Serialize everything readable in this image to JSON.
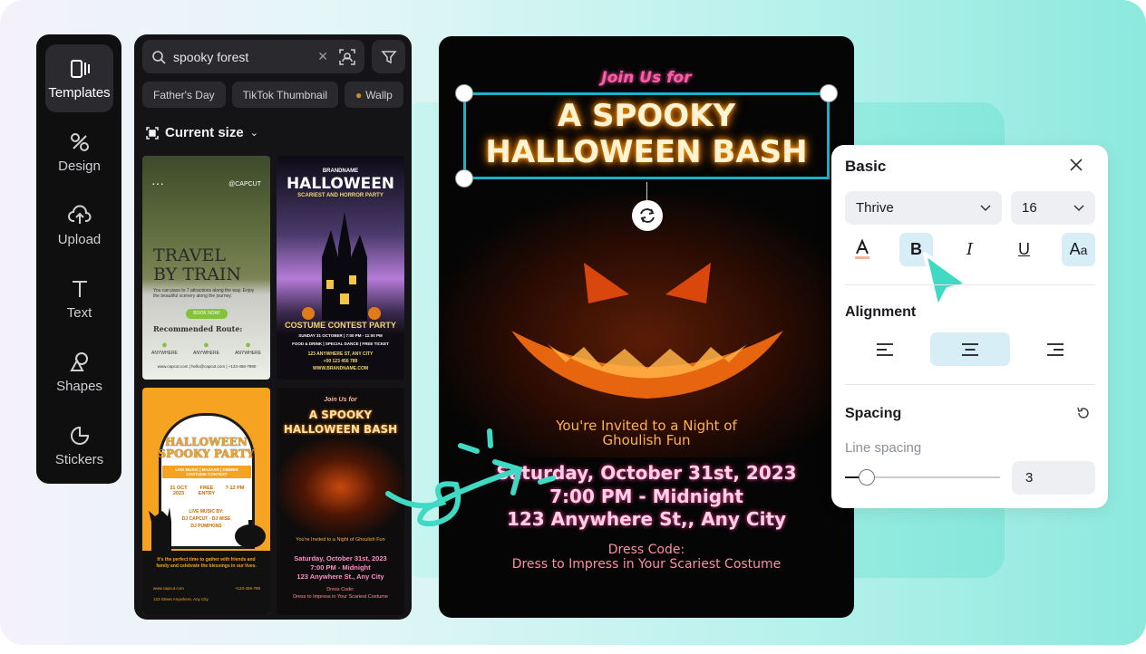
{
  "rail": {
    "items": [
      {
        "label": "Templates",
        "icon": "templates-icon"
      },
      {
        "label": "Design",
        "icon": "design-icon"
      },
      {
        "label": "Upload",
        "icon": "upload-icon"
      },
      {
        "label": "Text",
        "icon": "text-icon"
      },
      {
        "label": "Shapes",
        "icon": "shapes-icon"
      },
      {
        "label": "Stickers",
        "icon": "stickers-icon"
      }
    ]
  },
  "templates": {
    "search_value": "spooky forest",
    "chips": [
      "Father's Day",
      "TikTok Thumbnail",
      "Wallp"
    ],
    "size_label": "Current size",
    "t1": {
      "title1": "TRAVEL",
      "title2": "BY TRAIN",
      "handle": "@CAPCUT",
      "body": "You can pass to 7 attractions along the way. Enjoy the beautiful scenery along the journey.",
      "button": "BOOK NOW!",
      "route": "Recommended Route:",
      "stop": "ANYWHERE",
      "footer": "www.capcut.com | hello@capcut.com | +123-456-7890"
    },
    "t2": {
      "brand": "BRANDNAME",
      "title": "HALLOWEEN",
      "subtitle": "SCARIEST AND HORROR PARTY",
      "headline": "COSTUME CONTEST PARTY",
      "line1": "SUNDAY 31 OCTOBER | 7:00 PM - 11:00 PM",
      "line2": "FOOD & DRINK | SPECIAL DANCE | FREE TICKET",
      "line3": "123 ANYWHERE ST, ANY CITY",
      "line4": "+00 123 456 789",
      "line5": "WWW.BRANDNAME.COM"
    },
    "t3": {
      "title1": "HALLOWEEN",
      "title2": "SPOOKY PARTY",
      "tags1": "LIVE MUSIC | BAZAAR | DINNER",
      "tags2": "COSTUME CONTEST",
      "date": "31 OCT 2023",
      "entry": "FREE ENTRY",
      "time": "7-12 PM",
      "lm": "LIVE MUSIC BY:",
      "dj": "DJ CAPCUT - DJ WISE",
      "dj2": "DJ PUMPKINS",
      "blurb": "It's the perfect time to gather with friends and family and celebrate the blessings in our lives.",
      "web": "www.capcut.com",
      "phone": "+123-456-789",
      "addr": "123 Street Anywhere, Any City"
    },
    "t4": {
      "top": "Join Us for",
      "title1": "A SPOOKY",
      "title2": "HALLOWEEN BASH",
      "invite": "You're Invited to a Night of Ghoulish Fun",
      "date": "Saturday, October 31st, 2023",
      "time": "7:00 PM - Midnight",
      "addr": "123 Anywhere St., Any City",
      "dc": "Dress Code:",
      "dc2": "Dress to Impress in Your Scariest Costume"
    }
  },
  "canvas": {
    "top": "Join Us for",
    "title1": "A SPOOKY",
    "title2": "HALLOWEEN BASH",
    "invite1": "You're Invited to a Night of",
    "invite2": "Ghoulish Fun",
    "date": "Saturday, October 31st, 2023",
    "time": "7:00 PM - Midnight",
    "addr": "123 Anywhere St,, Any City",
    "dress1": "Dress Code:",
    "dress2": "Dress to Impress in Your Scariest Costume"
  },
  "props": {
    "title": "Basic",
    "font": "Thrive",
    "size": "16",
    "alignment_label": "Alignment",
    "spacing_label": "Spacing",
    "line_spacing_label": "Line spacing",
    "line_spacing_value": "3",
    "line_spacing_level": 0.1
  },
  "colors": {
    "accent": "#18b3c9",
    "teal": "#3fd9c4",
    "neon_pink": "#ff5ca8",
    "orange_glow": "#ffb347"
  }
}
